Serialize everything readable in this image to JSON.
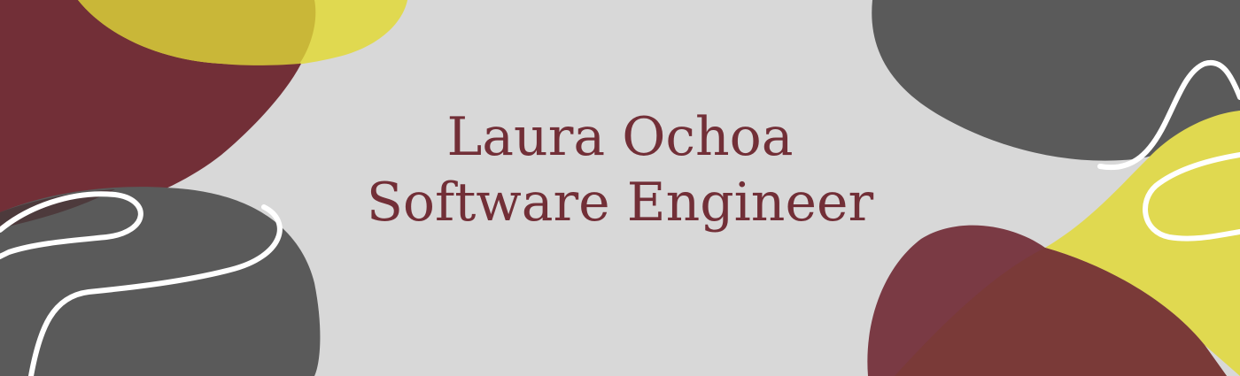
{
  "banner": {
    "name": "Laura Ochoa",
    "role": "Software Engineer"
  },
  "colors": {
    "background": "#d8d8d8",
    "text": "#722f37",
    "maroon": "#722f37",
    "yellow": "#e0d950",
    "gray": "#5a5a5a",
    "white_line": "#ffffff"
  }
}
